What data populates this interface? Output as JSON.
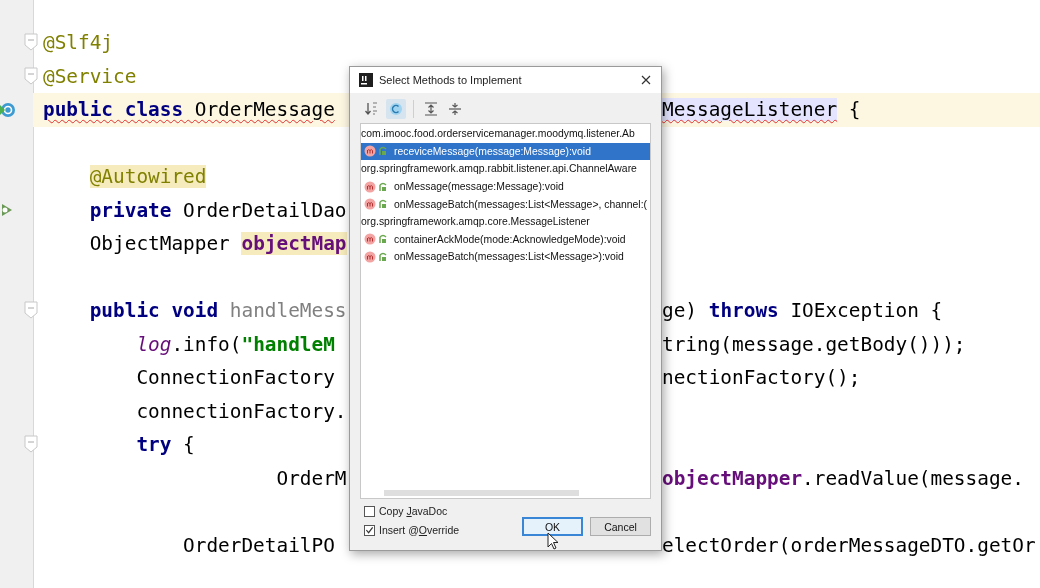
{
  "editor": {
    "lines": [
      {
        "kind": "plain",
        "fold": true,
        "current": false,
        "left": [
          {
            "text": "@Slf4j",
            "kind": "annotation"
          }
        ]
      },
      {
        "kind": "plain",
        "fold": true,
        "current": false,
        "left": [
          {
            "text": "@Service",
            "kind": "annotation"
          }
        ]
      },
      {
        "kind": "class",
        "fold": false,
        "current": true,
        "left": [
          {
            "text": "public",
            "kind": "keyword",
            "error": true
          },
          {
            "text": " class",
            "kind": "keyword",
            "error": true
          },
          {
            "text": " OrderMessage",
            "kind": "plain",
            "error": true
          }
        ],
        "right": [
          {
            "text": "MessageListener",
            "kind": "plain",
            "error": true,
            "reference": true
          },
          {
            "text": " {",
            "kind": "plain"
          }
        ],
        "children": [
          {
            "kind": "plain",
            "fold": false,
            "current": false
          },
          {
            "kind": "plain",
            "fold": false,
            "current": false,
            "left": [
              {
                "text": "@Autowired",
                "kind": "annotation",
                "warning": true
              }
            ]
          },
          {
            "kind": "bean",
            "fold": false,
            "current": false,
            "left": [
              {
                "text": "private",
                "kind": "keyword"
              },
              {
                "text": " OrderDetailDao",
                "kind": "plain"
              }
            ]
          },
          {
            "kind": "plain",
            "fold": false,
            "current": false,
            "left": [
              {
                "text": "ObjectMapper ",
                "kind": "plain"
              },
              {
                "text": "objectMap",
                "kind": "field",
                "warning": true
              }
            ]
          },
          {
            "kind": "plain",
            "fold": false,
            "current": false
          },
          {
            "kind": "plain",
            "fold": true,
            "current": false,
            "left": [
              {
                "text": "public",
                "kind": "keyword"
              },
              {
                "text": " void",
                "kind": "keyword"
              },
              {
                "text": " handleMess",
                "kind": "unused"
              }
            ],
            "right": [
              {
                "text": "ge) ",
                "kind": "plain"
              },
              {
                "text": "throws",
                "kind": "keyword"
              },
              {
                "text": " IOException {",
                "kind": "plain"
              }
            ],
            "children": [
              {
                "kind": "plain",
                "fold": false,
                "current": false,
                "left": [
                  {
                    "text": "log",
                    "kind": "static"
                  },
                  {
                    "text": ".info(",
                    "kind": "plain"
                  },
                  {
                    "text": "\"handleM",
                    "kind": "string"
                  }
                ],
                "right": [
                  {
                    "text": "tring(message.getBody()));",
                    "kind": "plain"
                  }
                ]
              },
              {
                "kind": "plain",
                "fold": false,
                "current": false,
                "left": [
                  {
                    "text": "ConnectionFactory",
                    "kind": "plain"
                  }
                ],
                "right": [
                  {
                    "text": "nectionFactory();",
                    "kind": "plain"
                  }
                ]
              },
              {
                "kind": "plain",
                "fold": false,
                "current": false,
                "left": [
                  {
                    "text": "connectionFactory.",
                    "kind": "plain"
                  }
                ]
              },
              {
                "kind": "plain",
                "fold": true,
                "current": false,
                "left": [
                  {
                    "text": "try",
                    "kind": "keyword"
                  },
                  {
                    "text": " {",
                    "kind": "plain"
                  }
                ],
                "children": [
                  {
                    "kind": "plain",
                    "fold": false,
                    "current": false,
                    "left": [
                      {
                        "text": "        OrderM",
                        "kind": "plain"
                      }
                    ],
                    "right": [
                      {
                        "text": "objectMapper",
                        "kind": "field"
                      },
                      {
                        "text": ".readValue(message.",
                        "kind": "plain"
                      }
                    ]
                  },
                  {
                    "kind": "plain",
                    "fold": false,
                    "current": false
                  },
                  {
                    "kind": "plain",
                    "fold": false,
                    "current": false,
                    "left": [
                      {
                        "text": "OrderDetailPO",
                        "kind": "plain"
                      }
                    ],
                    "right": [
                      {
                        "text": "electOrder(orderMessageDTO.getOr",
                        "kind": "plain"
                      }
                    ]
                  }
                ]
              }
            ]
          }
        ]
      }
    ]
  },
  "dialog": {
    "title": "Select Methods to Implement",
    "toolbar": [
      {
        "kind": "sort",
        "selected": false
      },
      {
        "kind": "classes",
        "selected": true
      },
      {
        "kind": "expand",
        "selected": false
      },
      {
        "kind": "collapse",
        "selected": false
      }
    ],
    "items": [
      {
        "kind": "group",
        "selected": false,
        "label": "com.imooc.food.orderservicemanager.moodymq.listener.Ab"
      },
      {
        "kind": "method",
        "selected": true,
        "label": "receviceMessage(message:Message):void"
      },
      {
        "kind": "group",
        "selected": false,
        "label": "org.springframework.amqp.rabbit.listener.api.ChannelAware"
      },
      {
        "kind": "method",
        "selected": false,
        "label": "onMessage(message:Message):void"
      },
      {
        "kind": "method",
        "selected": false,
        "label": "onMessageBatch(messages:List<Message>, channel:("
      },
      {
        "kind": "group",
        "selected": false,
        "label": "org.springframework.amqp.core.MessageListener"
      },
      {
        "kind": "method",
        "selected": false,
        "label": "containerAckMode(mode:AcknowledgeMode):void"
      },
      {
        "kind": "method",
        "selected": false,
        "label": "onMessageBatch(messages:List<Message>):void"
      }
    ],
    "options": [
      {
        "label_parts": [
          "Copy ",
          "J",
          "avaDoc"
        ],
        "checked": false
      },
      {
        "label_parts": [
          "Insert @",
          "O",
          "verride"
        ],
        "checked": true
      }
    ],
    "buttons": [
      {
        "label": "OK",
        "default": true
      },
      {
        "label": "Cancel",
        "default": false
      }
    ]
  }
}
